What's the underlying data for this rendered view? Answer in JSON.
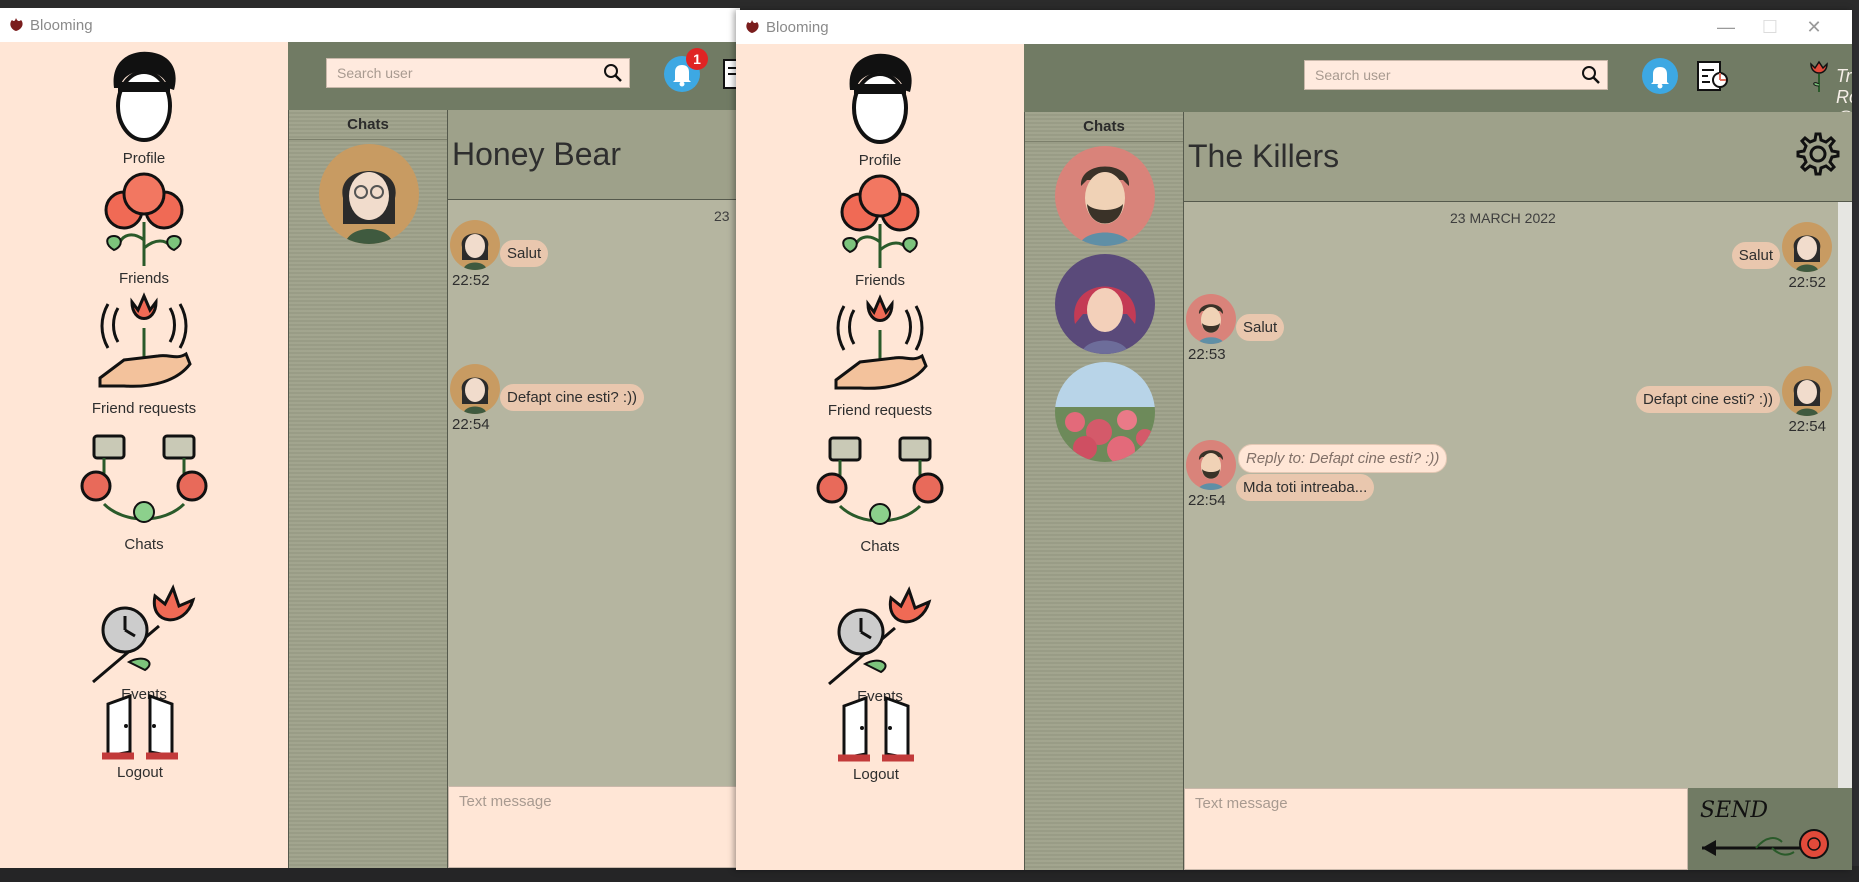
{
  "app": {
    "title": "Blooming"
  },
  "sidebar": {
    "items": [
      {
        "label": "Profile"
      },
      {
        "label": "Friends"
      },
      {
        "label": "Friend requests"
      },
      {
        "label": "Chats"
      },
      {
        "label": "Events"
      },
      {
        "label": "Logout"
      }
    ]
  },
  "window_a": {
    "search_placeholder": "Search user",
    "notification_count": "1",
    "chats_heading": "Chats",
    "conversation_title": "Honey Bear",
    "date_separator": "23",
    "messages": [
      {
        "text": "Salut",
        "time": "22:52"
      },
      {
        "text": "Defapt cine esti? :))",
        "time": "22:54"
      }
    ],
    "composer_placeholder": "Text message"
  },
  "window_b": {
    "search_placeholder": "Search user",
    "user": "Truth Rose | @honeyb",
    "chats_heading": "Chats",
    "conversation_title": "The Killers",
    "date_separator": "23 MARCH 2022",
    "messages": [
      {
        "side": "right",
        "text": "Salut",
        "time": "22:52"
      },
      {
        "side": "left",
        "text": "Salut",
        "time": "22:53"
      },
      {
        "side": "right",
        "text": "Defapt cine esti? :))",
        "time": "22:54"
      },
      {
        "side": "left",
        "reply_to": "Reply to: Defapt cine esti? :))",
        "text": "Mda toti intreaba...",
        "time": "22:54"
      }
    ],
    "composer_placeholder": "Text message",
    "send_label": "SEND"
  },
  "colors": {
    "sidebar_bg": "#ffe6d6",
    "header_bg": "#717b64",
    "chatlist_bg": "#9ea18a",
    "conversation_bg": "#b5b5a0",
    "bubble": "#e9c7ae",
    "notification_blue": "#3da8e3",
    "badge_red": "#e02424"
  }
}
